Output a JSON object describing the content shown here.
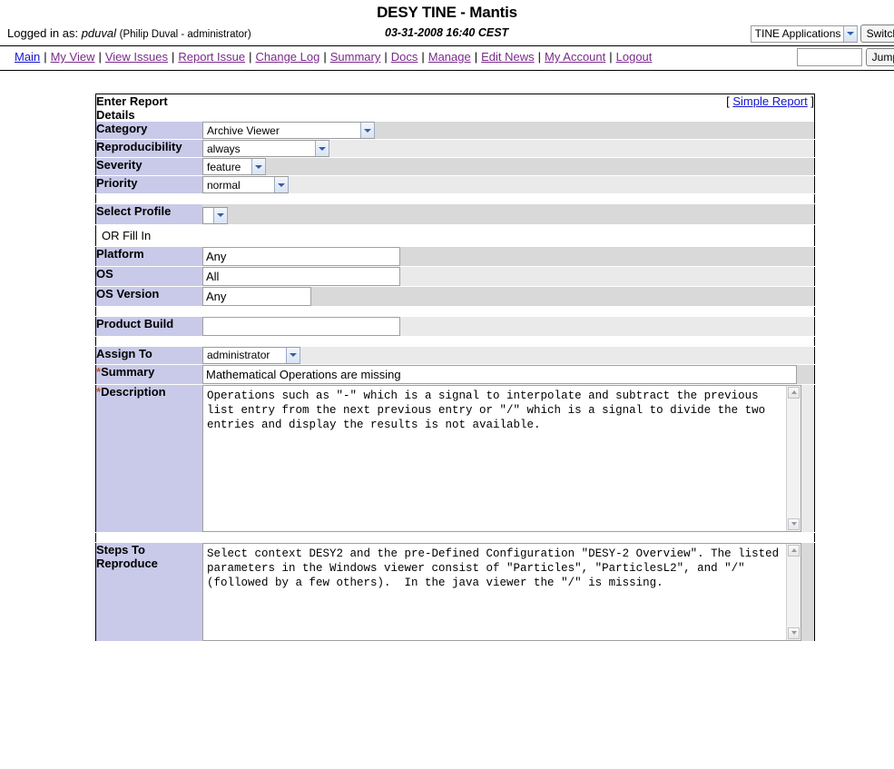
{
  "header": {
    "site_title": "DESY TINE - Mantis",
    "logged_in_prefix": "Logged in as:",
    "username": "pduval",
    "realname": "(Philip Duval - administrator)",
    "timestamp": "03-31-2008 16:40 CEST",
    "project_select_value": "TINE Applications",
    "switch_button": "Switch"
  },
  "nav": {
    "items": [
      {
        "label": "Main"
      },
      {
        "label": "My View"
      },
      {
        "label": "View Issues"
      },
      {
        "label": "Report Issue"
      },
      {
        "label": "Change Log"
      },
      {
        "label": "Summary"
      },
      {
        "label": "Docs"
      },
      {
        "label": "Manage"
      },
      {
        "label": "Edit News"
      },
      {
        "label": "My Account"
      },
      {
        "label": "Logout"
      }
    ],
    "separator": "|",
    "jump_value": "",
    "jump_button": "Jump"
  },
  "form": {
    "title_line1": "Enter Report",
    "title_line2": "Details",
    "simple_report_open": "[",
    "simple_report_link": "Simple Report",
    "simple_report_close": "]",
    "labels": {
      "category": "Category",
      "reproducibility": "Reproducibility",
      "severity": "Severity",
      "priority": "Priority",
      "select_profile": "Select Profile",
      "or_fill_in": "OR Fill In",
      "platform": "Platform",
      "os": "OS",
      "os_version": "OS Version",
      "product_build": "Product Build",
      "assign_to": "Assign To",
      "summary": "Summary",
      "description": "Description",
      "steps_to_reproduce_line1": "Steps To",
      "steps_to_reproduce_line2": "Reproduce"
    },
    "required_marker": "*",
    "values": {
      "category": "Archive Viewer",
      "reproducibility": "always",
      "severity": "feature",
      "priority": "normal",
      "select_profile": "",
      "platform": "Any",
      "os": "All",
      "os_version": "Any",
      "product_build": "",
      "assign_to": "administrator",
      "summary": "Mathematical Operations are missing",
      "description": "Operations such as \"-\" which is a signal to interpolate and subtract the previous list entry from the next previous entry or \"/\" which is a signal to divide the two entries and display the results is not available.",
      "steps_to_reproduce": "Select context DESY2 and the pre-Defined Configuration \"DESY-2 Overview\". The listed parameters in the Windows viewer consist of \"Particles\", \"ParticlesL2\", and \"/\" (followed by a few others).  In the java viewer the \"/\" is missing."
    }
  },
  "colors": {
    "label_bg": "#c9c9e9",
    "row_bg_dark": "#d9d9d9",
    "row_bg_light": "#eaeaea",
    "link_unvisited": "#1414cc",
    "link_visited": "#7a2a8a",
    "required_star": "#cc5522"
  }
}
